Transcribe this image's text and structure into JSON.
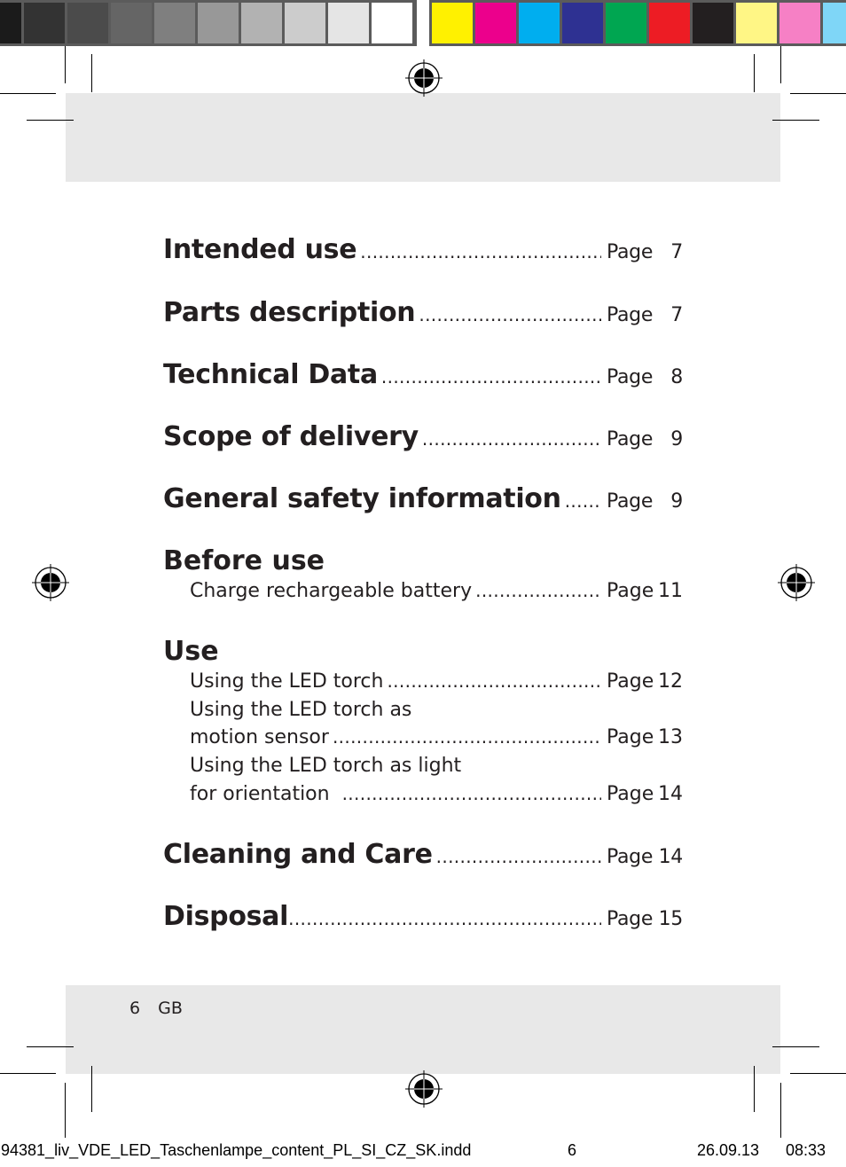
{
  "color_bars": {
    "gray": [
      "#1b1b1b",
      "#333333",
      "#4b4b4b",
      "#656565",
      "#7f7f7f",
      "#989898",
      "#b2b2b2",
      "#cccccc",
      "#e5e5e5",
      "#ffffff"
    ],
    "process": [
      "#fff100",
      "#ec008c",
      "#00aeef",
      "#2e3192",
      "#00a651",
      "#ed1c24",
      "#231f20",
      "#fff685",
      "#f680c5",
      "#7fd6f7"
    ]
  },
  "toc": {
    "page_label": "Page",
    "entries": [
      {
        "title": "Intended use",
        "page": "7"
      },
      {
        "title": "Parts description",
        "page": "7"
      },
      {
        "title": "Technical Data",
        "page": "8"
      },
      {
        "title": "Scope of delivery",
        "page": "9"
      },
      {
        "title": "General safety information",
        "page": "9"
      }
    ],
    "before_use": {
      "title": "Before use",
      "items": [
        {
          "title": "Charge rechargeable battery",
          "page": "11"
        }
      ]
    },
    "use": {
      "title": "Use",
      "items": [
        {
          "title": "Using the LED torch",
          "page": "12"
        },
        {
          "line1": "Using the LED torch as",
          "title": "motion sensor",
          "page": "13"
        },
        {
          "line1": "Using the LED torch as light",
          "title": "for orientation",
          "page": "14"
        }
      ]
    },
    "tail_entries": [
      {
        "title": "Cleaning and Care",
        "page": "14"
      },
      {
        "title": "Disposal",
        "page": "15"
      }
    ]
  },
  "folio": {
    "page_number": "6",
    "language": "GB"
  },
  "slug": {
    "filename": "94381_liv_VDE_LED_Taschenlampe_content_PL_SI_CZ_SK.indd",
    "page": "6",
    "date": "26.09.13",
    "time": "08:33"
  }
}
